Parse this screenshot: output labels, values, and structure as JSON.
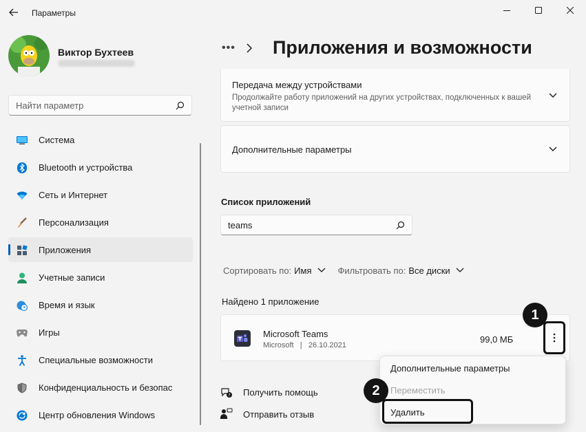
{
  "window": {
    "title": "Параметры"
  },
  "user": {
    "name": "Виктор Бухтеев"
  },
  "search": {
    "placeholder": "Найти параметр"
  },
  "sidebar": {
    "items": [
      {
        "label": "Система",
        "icon": "monitor-icon"
      },
      {
        "label": "Bluetooth и устройства",
        "icon": "bluetooth-icon"
      },
      {
        "label": "Сеть и Интернет",
        "icon": "wifi-icon"
      },
      {
        "label": "Персонализация",
        "icon": "brush-icon"
      },
      {
        "label": "Приложения",
        "icon": "apps-icon",
        "active": true
      },
      {
        "label": "Учетные записи",
        "icon": "person-icon"
      },
      {
        "label": "Время и язык",
        "icon": "globe-clock-icon"
      },
      {
        "label": "Игры",
        "icon": "gamepad-icon"
      },
      {
        "label": "Специальные возможности",
        "icon": "accessibility-icon"
      },
      {
        "label": "Конфиденциальность и безопас",
        "icon": "shield-icon"
      },
      {
        "label": "Центр обновления Windows",
        "icon": "update-icon"
      }
    ]
  },
  "breadcrumb": {
    "dots": "•••"
  },
  "page": {
    "title": "Приложения и возможности"
  },
  "cards": {
    "transfer": {
      "title": "Передача между устройствами",
      "description": "Продолжайте работу приложений на других устройствах, подключенных к вашей учетной записи"
    },
    "advanced": {
      "title": "Дополнительные параметры"
    }
  },
  "app_list": {
    "heading": "Список приложений",
    "search_value": "teams",
    "sort_label": "Сортировать по:",
    "sort_value": "Имя",
    "filter_label": "Фильтровать по:",
    "filter_value": "Все диски",
    "found_text": "Найдено 1 приложение"
  },
  "app": {
    "name": "Microsoft Teams",
    "publisher": "Microsoft",
    "separator": "|",
    "date": "26.10.2021",
    "size": "99,0 МБ"
  },
  "context_menu": {
    "items": [
      {
        "label": "Дополнительные параметры",
        "disabled": false
      },
      {
        "label": "Переместить",
        "disabled": true
      },
      {
        "label": "Удалить",
        "disabled": false
      }
    ]
  },
  "links": {
    "help": "Получить помощь",
    "feedback": "Отправить отзыв"
  },
  "annotations": {
    "step1": "1",
    "step2": "2"
  },
  "colors": {
    "accent": "#005fb8",
    "background": "#f3f3f3",
    "card": "#fbfbfb",
    "teams": "#5b5fc7"
  }
}
